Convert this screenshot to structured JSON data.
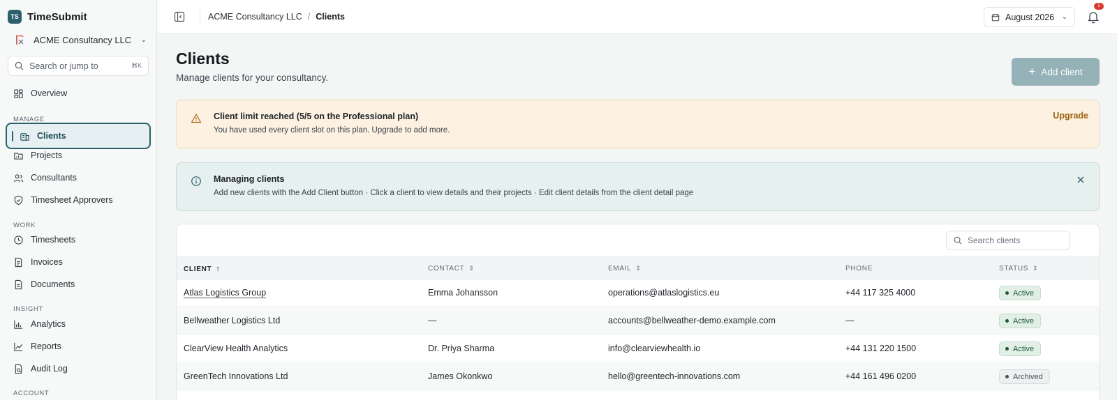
{
  "brand": {
    "logo_text": "TS",
    "name": "TimeSubmit"
  },
  "org": {
    "name": "ACME Consultancy LLC"
  },
  "sidebar_search": {
    "placeholder": "Search or jump to",
    "shortcut": "⌘K"
  },
  "nav": {
    "overview": "Overview",
    "manage_label": "MANAGE",
    "clients": "Clients",
    "projects": "Projects",
    "consultants": "Consultants",
    "approvers": "Timesheet Approvers",
    "work_label": "WORK",
    "timesheets": "Timesheets",
    "invoices": "Invoices",
    "documents": "Documents",
    "insight_label": "INSIGHT",
    "analytics": "Analytics",
    "reports": "Reports",
    "audit_log": "Audit Log",
    "account_label": "ACCOUNT"
  },
  "topbar": {
    "breadcrumb": {
      "org": "ACME Consultancy LLC",
      "separator": "/",
      "current": "Clients"
    },
    "month": "August 2026",
    "notification_count": "1"
  },
  "page": {
    "title": "Clients",
    "subtitle": "Manage clients for your consultancy.",
    "add_button": "Add client"
  },
  "alerts": {
    "limit": {
      "title": "Client limit reached (5/5 on the Professional plan)",
      "body": "You have used every client slot on this plan. Upgrade to add more.",
      "action": "Upgrade"
    },
    "info": {
      "title": "Managing clients",
      "body": "Add new clients with the Add Client button · Click a client to view details and their projects · Edit client details from the client detail page"
    }
  },
  "table": {
    "search_placeholder": "Search clients",
    "columns": {
      "client": "CLIENT",
      "contact": "CONTACT",
      "email": "EMAIL",
      "phone": "PHONE",
      "status": "STATUS"
    },
    "rows": [
      {
        "client": "Atlas Logistics Group",
        "contact": "Emma Johansson",
        "email": "operations@atlaslogistics.eu",
        "phone": "+44 117 325 4000",
        "status": "Active"
      },
      {
        "client": "Bellweather Logistics Ltd",
        "contact": "—",
        "email": "accounts@bellweather-demo.example.com",
        "phone": "—",
        "status": "Active"
      },
      {
        "client": "ClearView Health Analytics",
        "contact": "Dr. Priya Sharma",
        "email": "info@clearviewhealth.io",
        "phone": "+44 131 220 1500",
        "status": "Active"
      },
      {
        "client": "GreenTech Innovations Ltd",
        "contact": "James Okonkwo",
        "email": "hello@greentech-innovations.com",
        "phone": "+44 161 496 0200",
        "status": "Archived"
      }
    ]
  },
  "colors": {
    "brand": "#2c5f6c",
    "active_badge": "#1d5b34",
    "warn_bg": "#fdf1e1",
    "info_bg": "#e6f0ef"
  }
}
